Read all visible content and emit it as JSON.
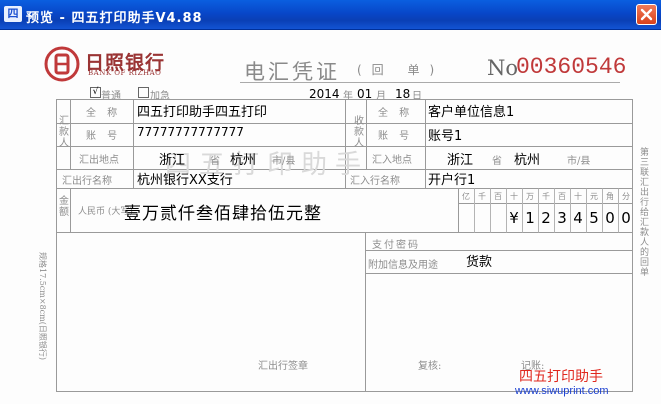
{
  "window": {
    "title": "预览 - 四五打印助手V4.88",
    "icon_text": "四"
  },
  "bank": {
    "name": "日照银行",
    "name_en": "BANK OF RIZHAO"
  },
  "form": {
    "title": "电汇凭证",
    "subtitle": "(回 单)",
    "no_prefix": "No",
    "number": "00360546",
    "checkbox_normal": "普通",
    "checkbox_urgent": "加急",
    "date": {
      "year": "2014",
      "month": "01",
      "day": "18",
      "year_unit": "年",
      "month_unit": "月",
      "day_unit": "日"
    }
  },
  "remitter": {
    "section_label": "汇款人",
    "name_label": "全 称",
    "name": "四五打印助手四五打印",
    "account_label": "账 号",
    "account": "77777777777777",
    "place_label": "汇出地点",
    "province": "浙江",
    "province_unit": "省",
    "city": "杭州",
    "city_unit": "市/县"
  },
  "payee": {
    "section_label": "收款人",
    "name_label": "全 称",
    "name": "客户单位信息1",
    "account_label": "账 号",
    "account": "账号1",
    "place_label": "汇入地点",
    "province": "浙江",
    "province_unit": "省",
    "city": "杭州",
    "city_unit": "市/县"
  },
  "out_bank": {
    "label": "汇出行名称",
    "value": "杭州银行XX支行"
  },
  "in_bank": {
    "label": "汇入行名称",
    "value": "开户行1"
  },
  "amount": {
    "label": "金额",
    "currency_label": "人民币 (大写)",
    "words": "壹万贰仟叁佰肆拾伍元整",
    "unit_headers": [
      "亿",
      "千",
      "百",
      "十",
      "万",
      "千",
      "百",
      "十",
      "元",
      "角",
      "分"
    ],
    "digits": [
      "",
      "",
      "",
      "¥",
      "1",
      "2",
      "3",
      "4",
      "5",
      "0",
      "0"
    ]
  },
  "payment_password_label": "支付密码",
  "extra_info_label": "附加信息及用途",
  "purpose": "货款",
  "stamp_label": "汇出行签章",
  "review_label": "复核:",
  "bookkeep_label": "记账:",
  "side_note": "第三联 汇出行给汇款人的回单",
  "left_note": "规格17.5cm×8cm(日照银行)",
  "watermark": "四五打印助手",
  "brand": "四五打印助手",
  "brand_url": "www.siwuprint.com",
  "colors": {
    "titlebar": "#0a4fd6",
    "form_red": "#c0393a",
    "label_grey": "#8d8d8d",
    "brand_red": "#e0281e",
    "brand_blue": "#1a3fd0"
  }
}
